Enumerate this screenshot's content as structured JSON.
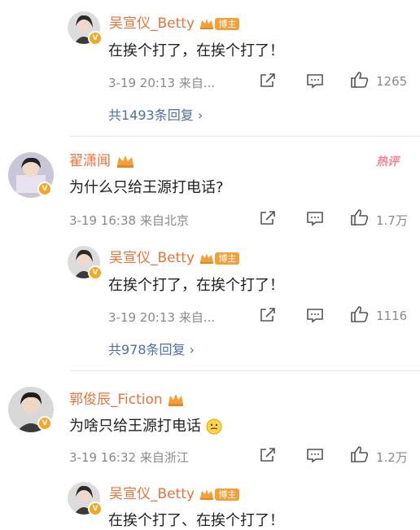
{
  "comments": [
    {
      "id": "r1",
      "username": "吴宣仪_Betty",
      "tag": "博主",
      "content": "在挨个打了，在挨个打了！",
      "time": "3-19 20:13",
      "location": "来自...",
      "likes": "1265",
      "more_replies": "共1493条回复"
    },
    {
      "id": "c1",
      "username": "翟潇闻",
      "hot_label": "热评",
      "content": "为什么只给王源打电话?",
      "time": "3-19 16:38",
      "location": "来自北京",
      "likes": "1.7万"
    },
    {
      "id": "r2",
      "username": "吴宣仪_Betty",
      "tag": "博主",
      "content": "在挨个打了，在挨个打了！",
      "time": "3-19 20:13",
      "location": "来自...",
      "likes": "1116",
      "more_replies": "共978条回复"
    },
    {
      "id": "c2",
      "username": "郭俊辰_Fiction",
      "content": "为啥只给王源打电话",
      "emoji": "thinking-emoji",
      "time": "3-19 16:32",
      "location": "来自浙江",
      "likes": "1.2万"
    },
    {
      "id": "r3",
      "username": "吴宣仪_Betty",
      "tag": "博主",
      "content": "在挨个打了、在挨个打了！"
    }
  ],
  "colors": {
    "username": "#e8733a",
    "reply_link": "#4f6fa8",
    "meta": "#8a8a8a",
    "tag_bg": "#f3a03b",
    "hot": "#ff8294",
    "verified": "#f5a623"
  }
}
